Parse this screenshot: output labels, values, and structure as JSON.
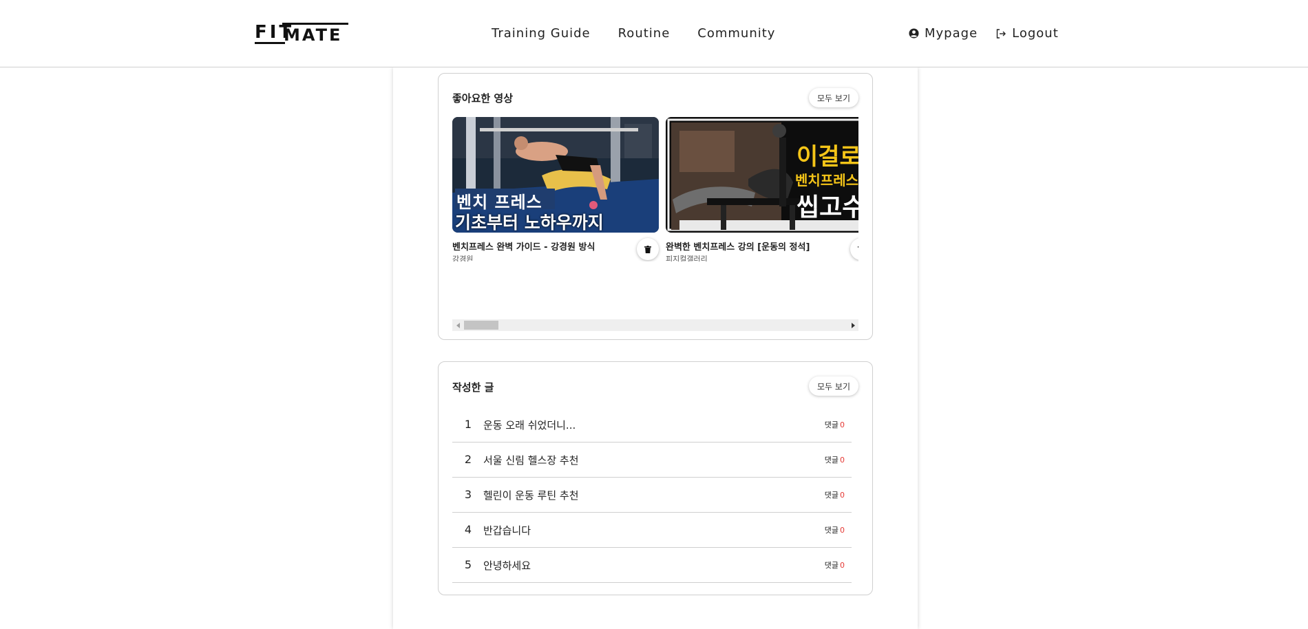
{
  "header": {
    "logo_text_1": "FIT",
    "logo_text_2": "MATE",
    "nav": [
      "Training Guide",
      "Routine",
      "Community"
    ],
    "mypage_label": "Mypage",
    "logout_label": "Logout"
  },
  "liked_videos": {
    "title": "좋아요한 영상",
    "view_all_label": "모두 보기",
    "items": [
      {
        "title": "벤치프레스 완벽 가이드 - 강경원 방식",
        "channel": "강경원",
        "thumb_line_1": "벤치 프레스",
        "thumb_line_2": "기초부터 노하우까지"
      },
      {
        "title": "완벽한 벤치프레스 강의 [운동의 정석]",
        "channel": "피지컬갤러리",
        "thumb_line_1": "이걸로",
        "thumb_line_2": "벤치프레스",
        "thumb_line_3": "씹고수"
      }
    ]
  },
  "my_posts": {
    "title": "작성한 글",
    "view_all_label": "모두 보기",
    "comment_label": "댓글",
    "items": [
      {
        "num": "1",
        "title": "운동 오래 쉬었더니...",
        "comments": "0"
      },
      {
        "num": "2",
        "title": "서울 신림 헬스장 추천",
        "comments": "0"
      },
      {
        "num": "3",
        "title": "헬린이 운동 루틴 추천",
        "comments": "0"
      },
      {
        "num": "4",
        "title": "반갑습니다",
        "comments": "0"
      },
      {
        "num": "5",
        "title": "안녕하세요",
        "comments": "0"
      }
    ]
  },
  "colors": {
    "comment_count": "#e53935",
    "thumb_caption_bg": "#1f3d6e",
    "thumb2_text": "#f5c518"
  }
}
